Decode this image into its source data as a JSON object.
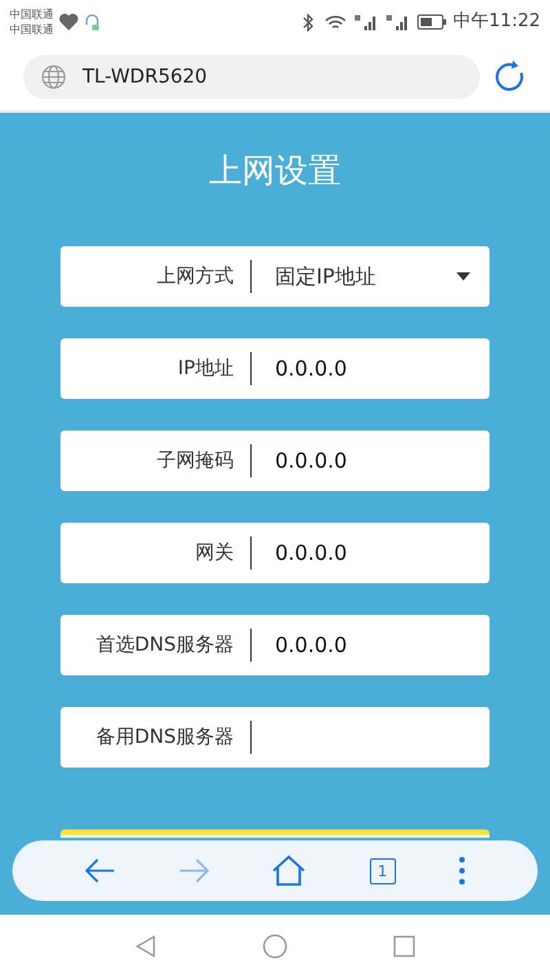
{
  "status_bar": {
    "carriers": [
      "中国联通",
      "中国联通"
    ],
    "time": "中午11:22"
  },
  "address_bar": {
    "url": "TL-WDR5620"
  },
  "page": {
    "title": "上网设置",
    "fields": [
      {
        "kind": "select",
        "label": "上网方式",
        "value": "固定IP地址"
      },
      {
        "kind": "text",
        "label": "IP地址",
        "value": "0.0.0.0"
      },
      {
        "kind": "text",
        "label": "子网掩码",
        "value": "0.0.0.0"
      },
      {
        "kind": "text",
        "label": "网关",
        "value": "0.0.0.0"
      },
      {
        "kind": "text",
        "label": "首选DNS服务器",
        "value": "0.0.0.0"
      },
      {
        "kind": "text",
        "label": "备用DNS服务器"
      }
    ]
  },
  "toolbar": {
    "tab_count": "1"
  }
}
